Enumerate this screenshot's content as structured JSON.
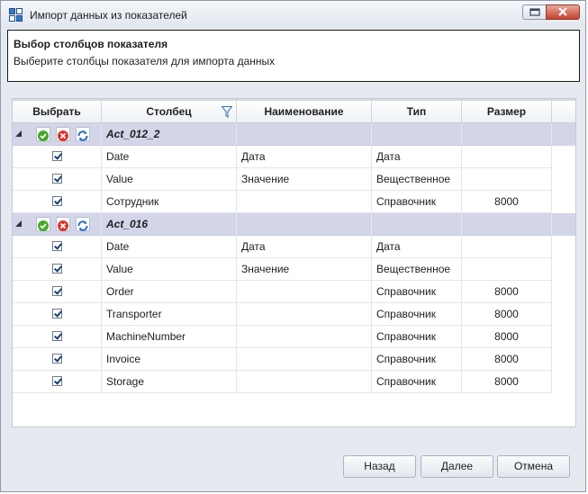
{
  "window": {
    "title": "Импорт данных из показателей"
  },
  "header": {
    "title": "Выбор столбцов показателя",
    "subtitle": "Выберите столбцы показателя для импорта данных"
  },
  "grid": {
    "columns": {
      "select": "Выбрать",
      "column": "Столбец",
      "name": "Наименование",
      "type": "Тип",
      "size": "Размер"
    },
    "groups": [
      {
        "name": "Act_012_2",
        "rows": [
          {
            "column": "Date",
            "name": "Дата",
            "type": "Дата",
            "size": "",
            "checked": true
          },
          {
            "column": "Value",
            "name": "Значение",
            "type": "Вещественное",
            "size": "",
            "checked": true
          },
          {
            "column": "Сотрудник",
            "name": "",
            "type": "Справочник",
            "size": "8000",
            "checked": true
          }
        ]
      },
      {
        "name": "Act_016",
        "rows": [
          {
            "column": "Date",
            "name": "Дата",
            "type": "Дата",
            "size": "",
            "checked": true
          },
          {
            "column": "Value",
            "name": "Значение",
            "type": "Вещественное",
            "size": "",
            "checked": true
          },
          {
            "column": "Order",
            "name": "",
            "type": "Справочник",
            "size": "8000",
            "checked": true
          },
          {
            "column": "Transporter",
            "name": "",
            "type": "Справочник",
            "size": "8000",
            "checked": true
          },
          {
            "column": "MachineNumber",
            "name": "",
            "type": "Справочник",
            "size": "8000",
            "checked": true
          },
          {
            "column": "Invoice",
            "name": "",
            "type": "Справочник",
            "size": "8000",
            "checked": true
          },
          {
            "column": "Storage",
            "name": "",
            "type": "Справочник",
            "size": "8000",
            "checked": true
          }
        ]
      }
    ]
  },
  "buttons": {
    "back": "Назад",
    "next": "Далее",
    "cancel": "Отмена"
  },
  "icons": {
    "app": "table-import-icon",
    "filter": "funnel-filter-icon",
    "select_all": "green-check-icon",
    "deselect_all": "red-cross-icon",
    "refresh": "blue-refresh-icon"
  }
}
